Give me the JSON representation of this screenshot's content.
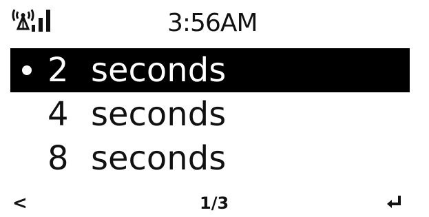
{
  "status_bar": {
    "wifi_icon": "wifi-signal-icon",
    "time": "3:56AM"
  },
  "list": {
    "items": [
      {
        "value": "2",
        "unit": "seconds",
        "selected": true
      },
      {
        "value": "4",
        "unit": "seconds",
        "selected": false
      },
      {
        "value": "8",
        "unit": "seconds",
        "selected": false
      }
    ]
  },
  "bottom_bar": {
    "back_symbol": "<",
    "page": "1/3",
    "enter_icon": "enter-icon"
  },
  "colors": {
    "background": "#ffffff",
    "foreground": "#111111",
    "highlight": "#000000"
  }
}
